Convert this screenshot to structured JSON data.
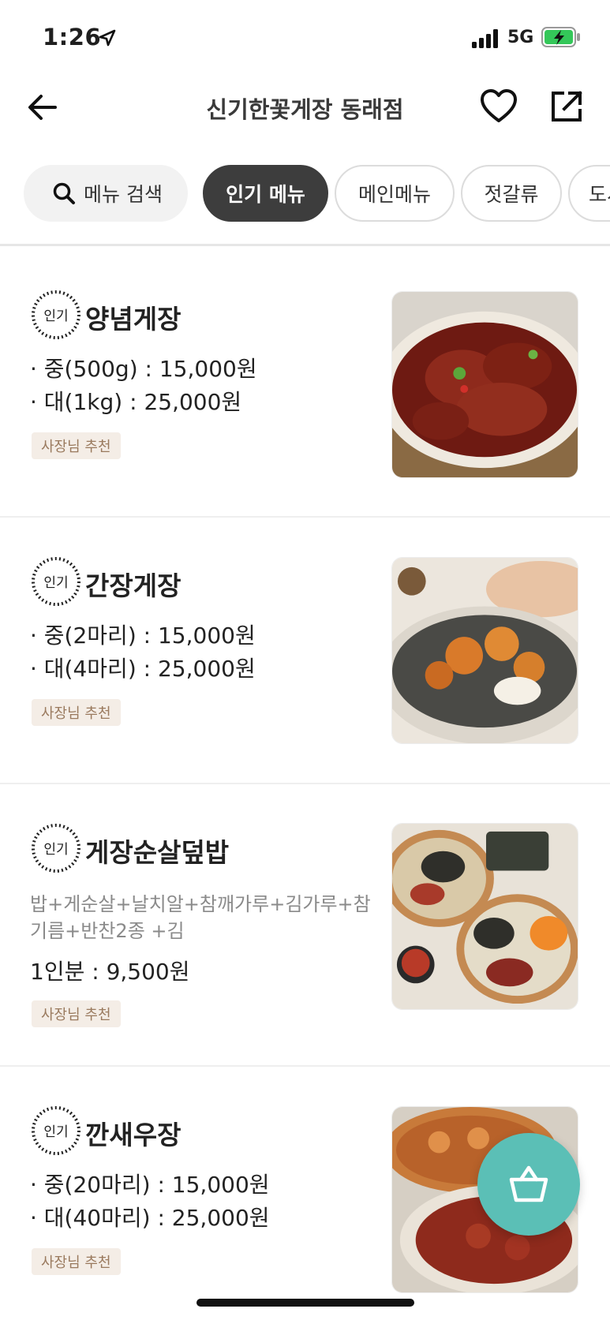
{
  "status_bar": {
    "time": "1:26",
    "network": "5G"
  },
  "header": {
    "title": "신기한꽃게장 동래점"
  },
  "chips": [
    {
      "label": "메뉴 검색",
      "icon": "search-icon"
    },
    {
      "label": "인기 메뉴",
      "active": true
    },
    {
      "label": "메인메뉴"
    },
    {
      "label": "젓갈류"
    },
    {
      "label": "도시"
    }
  ],
  "badge_text": "인기",
  "menu_items": [
    {
      "name": "양념게장",
      "prices": [
        "· 중(500g) : 15,000원",
        "· 대(1kg) : 25,000원"
      ],
      "tag": "사장님 추천"
    },
    {
      "name": "간장게장",
      "prices": [
        "· 중(2마리) : 15,000원",
        "· 대(4마리) : 25,000원"
      ],
      "tag": "사장님 추천"
    },
    {
      "name": "게장순살덮밥",
      "description": [
        "밥+게순살+날치알+참깨가루+김가루+참",
        "기름+반찬2종 +김"
      ],
      "prices": [
        "1인분 : 9,500원"
      ],
      "tag": "사장님 추천"
    },
    {
      "name": "깐새우장",
      "prices": [
        "· 중(20마리) : 15,000원",
        "· 대(40마리) : 25,000원"
      ],
      "tag": "사장님 추천"
    }
  ],
  "colors": {
    "accent": "#5bbfb6",
    "active_chip": "#3d3d3d",
    "tag_bg": "#f4ede6",
    "tag_text": "#9a7a5e"
  }
}
